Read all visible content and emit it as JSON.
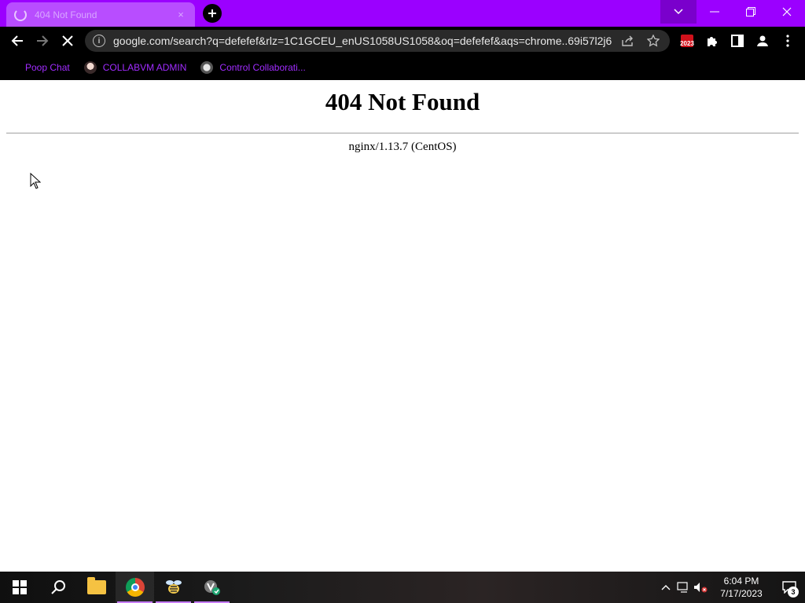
{
  "browser": {
    "tab": {
      "title": "404 Not Found",
      "close_glyph": "×"
    },
    "address_bar": {
      "url": "google.com/search?q=defefef&rlz=1C1GCEU_enUS1058US1058&oq=defefef&aqs=chrome..69i57l2j6..."
    },
    "bookmarks": [
      {
        "label": "Poop Chat",
        "icon": "none"
      },
      {
        "label": "COLLABVM ADMIN",
        "icon": "anime-avatar-icon"
      },
      {
        "label": "Control Collaborati...",
        "icon": "badge-icon"
      }
    ],
    "extension_badge": "2023",
    "accent_color": "#9b00ff"
  },
  "page": {
    "heading": "404 Not Found",
    "server": "nginx/1.13.7 (CentOS)"
  },
  "taskbar": {
    "clock": {
      "time": "6:04 PM",
      "date": "7/17/2023"
    },
    "notification_count": "3",
    "apps": [
      "start-icon",
      "search-icon",
      "file-explorer-icon",
      "chrome-icon",
      "bee-app-icon",
      "vm-app-icon"
    ]
  }
}
